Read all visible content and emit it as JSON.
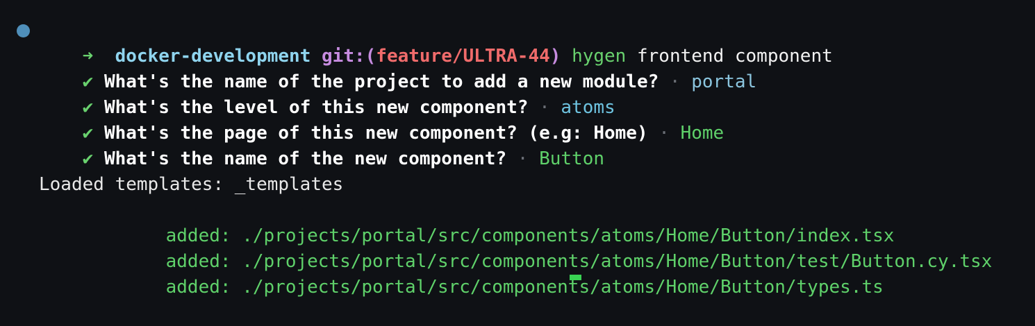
{
  "prompt": {
    "arrow": "➜",
    "directory": "docker-development",
    "git_label": "git:(",
    "branch": "feature/ULTRA-44",
    "git_close": ")",
    "command": "hygen",
    "args": "frontend component"
  },
  "qa": [
    {
      "check": "✔",
      "question": "What's the name of the project to add a new module?",
      "separator": "·",
      "answer": "portal"
    },
    {
      "check": "✔",
      "question": "What's the level of this new component?",
      "separator": "·",
      "answer": "atoms"
    },
    {
      "check": "✔",
      "question": "What's the page of this new component? (e.g: Home)",
      "separator": "·",
      "answer": "Home"
    },
    {
      "check": "✔",
      "question": "What's the name of the new component?",
      "separator": "·",
      "answer": "Button"
    }
  ],
  "loaded_templates": "Loaded templates: _templates",
  "added_files": [
    {
      "label": "added:",
      "path": "./projects/portal/src/components/atoms/Home/Button/index.tsx"
    },
    {
      "label": "added:",
      "path": "./projects/portal/src/components/atoms/Home/Button/test/Button.cy.tsx"
    },
    {
      "label": "added:",
      "path": "./projects/portal/src/components/atoms/Home/Button/types.ts"
    }
  ],
  "colors": {
    "background": "#0f1115",
    "prompt_dot": "#4f8fba",
    "success_green": "#5fd16a",
    "branch_red": "#ef6b6b",
    "git_purple": "#c78ce0",
    "dir_cyan": "#8fd4ee",
    "cursor_green": "#39d353"
  }
}
